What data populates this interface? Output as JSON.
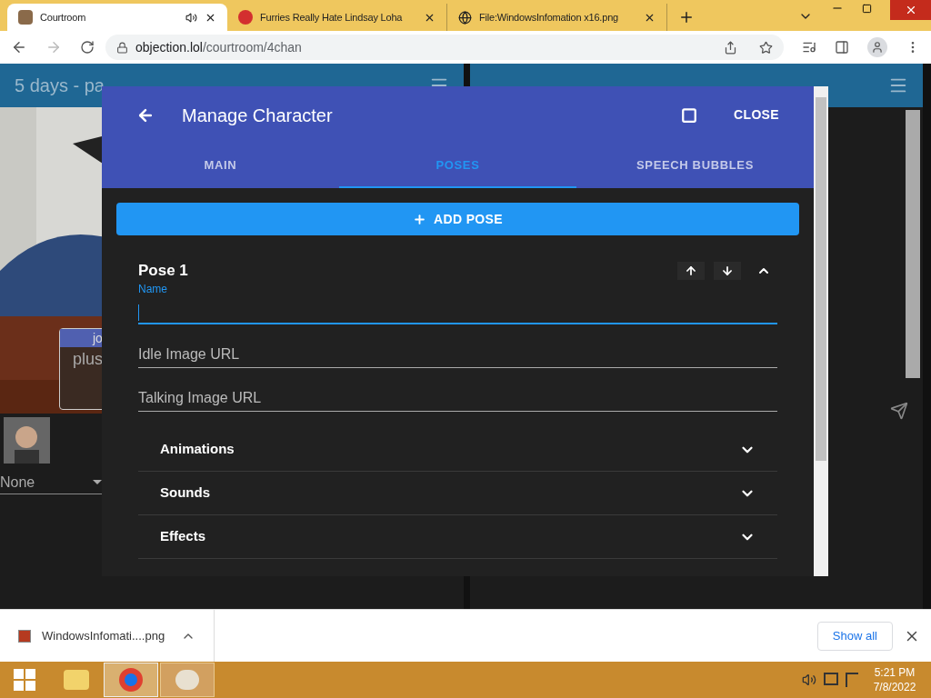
{
  "browser_tabs": [
    {
      "title": "Courtroom",
      "selected": true,
      "audio": true
    },
    {
      "title": "Furries Really Hate Lindsay Loha",
      "selected": false,
      "audio": false
    },
    {
      "title": "File:WindowsInfomation x16.png",
      "selected": false,
      "audio": false
    }
  ],
  "address": {
    "host": "objection.lol",
    "path": "/courtroom/4chan"
  },
  "page": {
    "left_title": "5 days - pa",
    "nameplate": {
      "name": "jo",
      "text": "plus"
    },
    "pose_select": "None"
  },
  "dialog": {
    "title": "Manage Character",
    "close": "CLOSE",
    "tabs": [
      {
        "label": "MAIN",
        "selected": false
      },
      {
        "label": "POSES",
        "selected": true
      },
      {
        "label": "SPEECH BUBBLES",
        "selected": false
      }
    ],
    "add_button": "ADD POSE",
    "pose": {
      "title": "Pose 1",
      "expanded": true,
      "fields": [
        {
          "label": "Name",
          "focused": true
        },
        {
          "label": "Idle Image URL",
          "focused": false
        },
        {
          "label": "Talking Image URL",
          "focused": false
        }
      ],
      "sections": [
        {
          "label": "Animations",
          "expanded": false
        },
        {
          "label": "Sounds",
          "expanded": false
        },
        {
          "label": "Effects",
          "expanded": false
        }
      ]
    }
  },
  "download": {
    "file": "WindowsInfomati....png",
    "show_all": "Show all"
  },
  "clock": {
    "time": "5:21 PM",
    "date": "7/8/2022"
  }
}
